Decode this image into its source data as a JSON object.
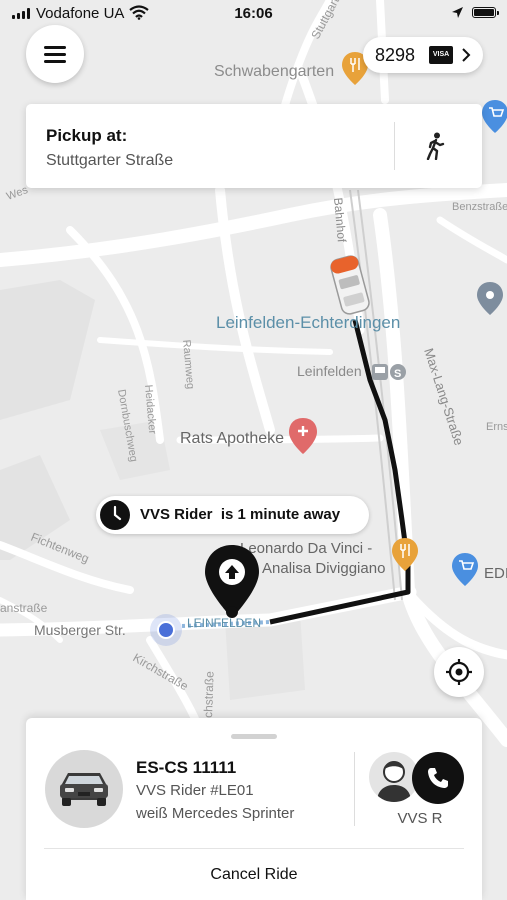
{
  "status_bar": {
    "carrier": "Vodafone UA",
    "time": "16:06"
  },
  "header": {
    "points": "8298",
    "card": "VISA"
  },
  "pickup": {
    "label": "Pickup at:",
    "address": "Stuttgarter Straße"
  },
  "map": {
    "labels": {
      "schwabengarten": "Schwabengarten",
      "stuttgarter": "Stuttgarter",
      "bahnhof": "Bahnhof",
      "benzstr": "Benzstraße",
      "leinfelden_echterdingen": "Leinfelden-Echterdingen",
      "leinfelden": "Leinfelden",
      "max_lang": "Max-Lang-Straße",
      "rats_apotheke": "Rats Apotheke",
      "ernst": "Erns",
      "dornbuschweg": "Dornbuschweg",
      "heidacker": "Heidacker",
      "raumweg": "Raumweg",
      "leonardo1": "Leonardo Da Vinci -",
      "leonardo2": "Analisa Diviggiano",
      "edi": "EDI",
      "fichtenweg": "Fichtenweg",
      "anstrasse": "anstraße",
      "musberger": "Musberger Str.",
      "kirchstrasse": "Kirchstraße",
      "leinfelden_route": "LEINFELDEN",
      "kirchstr2": "chstraße",
      "west": "Wes"
    }
  },
  "eta": {
    "driver": "VVS Rider",
    "message": "is 1 minute away"
  },
  "ride": {
    "plate": "ES-CS 11111",
    "rider": "VVS Rider #LE01",
    "vehicle": "weiß Mercedes Sprinter",
    "driver_name": "VVS R",
    "cancel_label": "Cancel Ride"
  }
}
